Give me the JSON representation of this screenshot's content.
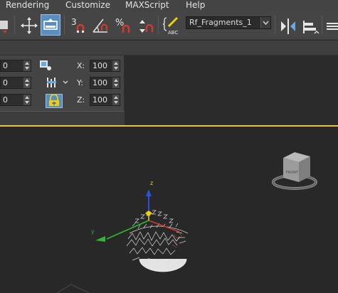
{
  "menu": {
    "items": [
      {
        "label": "Rendering"
      },
      {
        "label": "Customize"
      },
      {
        "label": "MAXScript"
      },
      {
        "label": "Help"
      }
    ]
  },
  "toolbar": {
    "selection_set": "Rf_Fragments_1",
    "buttons": [
      {
        "icon": "render-frame-icon"
      },
      {
        "icon": "move-icon"
      },
      {
        "icon": "select-place-icon"
      },
      {
        "icon": "snap-3d-icon"
      },
      {
        "icon": "angle-snap-icon"
      },
      {
        "icon": "percent-snap-icon"
      },
      {
        "icon": "spinner-snap-icon"
      },
      {
        "icon": "edit-named-selections-icon"
      },
      {
        "icon": "mirror-icon"
      },
      {
        "icon": "align-icon"
      },
      {
        "icon": "layer-icon"
      }
    ]
  },
  "transform_panel": {
    "left_values": [
      "0",
      "0",
      "0"
    ],
    "x_label": "X:",
    "y_label": "Y:",
    "z_label": "Z:",
    "x_value": "100",
    "y_value": "100",
    "z_value": "100"
  },
  "viewport": {
    "gizmo_z_label": "z",
    "gizmo_y_label": "y",
    "accent_border": "#e8c34b",
    "axis_colors": {
      "x": "#d23a2b",
      "y": "#2eb82e",
      "z": "#2b4fe0",
      "highlight": "#f0d000"
    }
  }
}
